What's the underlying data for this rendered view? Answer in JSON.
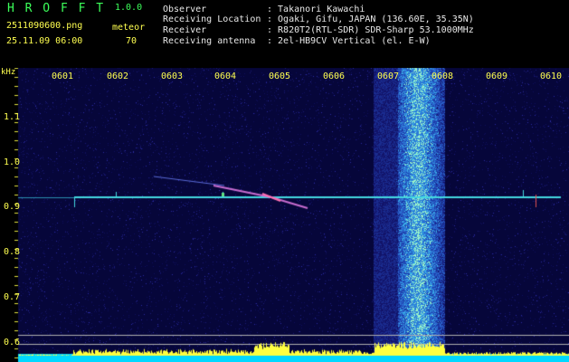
{
  "app": {
    "name": "H R O F F T",
    "version": "1.0.0",
    "filename": "2511090600.png",
    "datetime": "25.11.09 06:00",
    "mode_label": "meteor",
    "mode_value": "70"
  },
  "info": {
    "labels": [
      "Observer",
      "Receiving Location",
      "Receiver",
      "Receiving antenna"
    ],
    "values": [
      ": Takanori Kawachi",
      ": Ogaki, Gifu, JAPAN (136.60E, 35.35N)",
      ": R820T2(RTL-SDR) SDR-Sharp 53.1000MHz",
      ": 2el-HB9CV Vertical (el. E-W)"
    ]
  },
  "spectrogram": {
    "y_unit": "kHz",
    "y_ticks": [
      "1.1",
      "1.0",
      "0.9",
      "0.8",
      "0.7",
      "0.6"
    ],
    "x_ticks": [
      "0601",
      "0602",
      "0603",
      "0604",
      "0605",
      "0606",
      "0607",
      "0608",
      "0609",
      "0610"
    ],
    "colors": {
      "background": "#06063a",
      "tick_text": "#ffff50",
      "carrier": "#44d8e0",
      "meteor": "#c86cd0",
      "bottom_bar": "#00d8ff",
      "bottom_peaks": "#ffff40"
    }
  }
}
